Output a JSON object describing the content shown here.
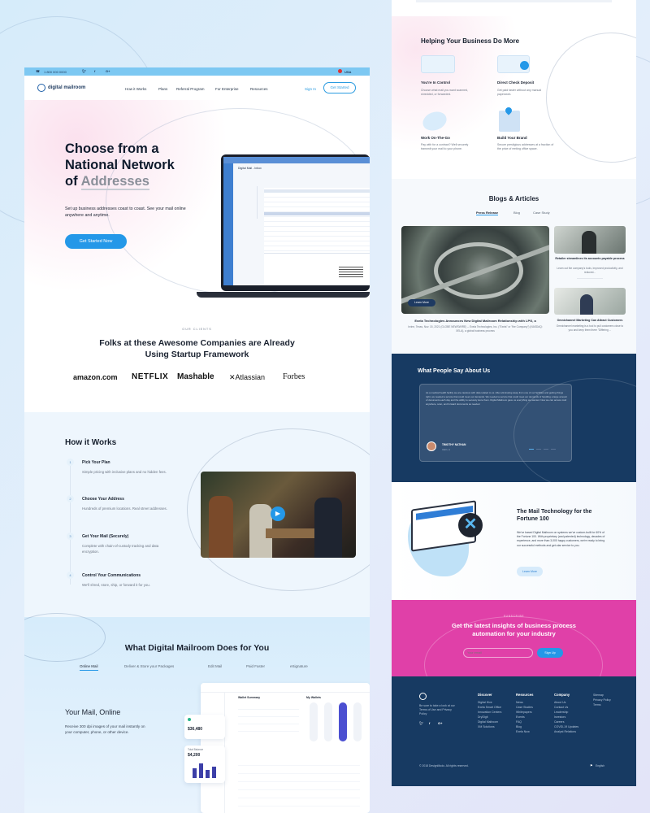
{
  "topbar": {
    "phone": "1 800 000 0000",
    "lang": "USA"
  },
  "nav": {
    "logo": "digital mailroom",
    "links": [
      "How it Works",
      "Plans",
      "Referral Program",
      "For Enterprise",
      "Resources"
    ],
    "signin": "Sign In",
    "cta": "Get Started"
  },
  "hero": {
    "title_line1": "Choose from a",
    "title_line2": "National Network",
    "title_of": "of",
    "title_highlight": "Addresses",
    "subtitle": "Set up business addresses coast to coast. See your mail online anywhere and anytime.",
    "cta": "Get Started Now",
    "mock_title": "Digital Mail - Inbox"
  },
  "clients": {
    "eyebrow": "OUR CLIENTS",
    "title": "Folks at these Awesome Companies are Already Using Startup Framework",
    "logos": [
      "amazon.com",
      "NETFLIX",
      "Mashable",
      "Atlassian",
      "Forbes"
    ]
  },
  "how": {
    "title": "How it Works",
    "steps": [
      {
        "num": "1",
        "title": "Pick Your Plan",
        "desc": "Simple pricing with inclusive plans and no hidden fees."
      },
      {
        "num": "2",
        "title": "Choose Your Address",
        "desc": "Hundreds of premium locations. Real street addresses."
      },
      {
        "num": "3",
        "title": "Get Your Mail (Securely)",
        "desc": "Complete with chain-of-custody tracking and data encryption."
      },
      {
        "num": "4",
        "title": "Control Your Communications",
        "desc": "We'll shred, store, ship, or forward it for you."
      }
    ]
  },
  "does": {
    "title": "What Digital Mailroom Does for You",
    "tabs": [
      "Online Mail",
      "Deliver & Store your Packages",
      "Edit Mail",
      "Paid Faster",
      "eSignature"
    ],
    "feature_title": "Your Mail, Online",
    "feature_desc": "Receive 300 dpi images of your mail instantly on your computer, phone, or other device.",
    "dash_wallet": "Wallet Summary",
    "dash_mywallets": "My Wallets",
    "balance1": "$36,480",
    "balance_label": "Total Balance",
    "balance2": "$4,200"
  },
  "helping": {
    "title": "Helping Your Business Do More",
    "items": [
      {
        "title": "You're In Control",
        "desc": "Choose what mail you want scanned, shredded, or forwarded."
      },
      {
        "title": "Direct Check Deposit",
        "desc": "Get paid faster without any manual paperwork."
      },
      {
        "title": "Work On-The-Go",
        "desc": "Pay with for a contract? Well securely transmit your mail to your phone."
      },
      {
        "title": "Build Your Brand",
        "desc": "Secure prestigious addresses at a fraction of the price of renting office space."
      }
    ]
  },
  "blogs": {
    "title": "Blogs & Articles",
    "tabs": [
      "Press Release",
      "Blog",
      "Case Study"
    ],
    "main_caption": "Exela Technologies Announces New Digital Mailroom Relationship with LPG, a",
    "main_desc": "Irvine, Texas, Nov. 15, 2021 (GLOBE NEWSWIRE) -- Exela Technologies, Inc. (\"Exela\" or \"the Company\") (NASDAQ: XELA), a global business process",
    "learn": "Learn More",
    "side1_title": "Retailer streamlines its accounts payable process",
    "side1_desc": "Learn out the company's tools, improved productivity, and reduced...",
    "side2_title": "Omnichannel Marketing Can Attract Customers",
    "side2_desc": "Omnichannel marketing is a tool to pull customers close to you and keep them there \"Differing ..."
  },
  "testimonials": {
    "title": "What People Say About Us",
    "quote": "As a medical health facility we are cautious with data related to us. After eliminating away from one of our facilities and getting things right, we needed a service that could meet our demands. We needed a service that could meet our demands of handling a large amount of documents each day and the ability to securely store them. Digital Mailroom gave us everything we wanted. Now we can access mail anywhere, scan, and forward documents as needed.",
    "name": "TIMOTHY NATHAN",
    "role": "CEO, A"
  },
  "fortune": {
    "title": "The Mail Technology for the Fortune 100",
    "desc": "We've based Digital Mailroom on systems we've custom-built for 60% of the Fortune 100. With proprietary (and patented) technology, decades of experience, and more than 3,000 happy customers, we're ready to bring our successful methods and get-star service to you.",
    "cta": "Learn More"
  },
  "subscribe": {
    "eyebrow": "SUBSCRIBE",
    "title": "Get the latest insights of business process automation for your industry",
    "placeholder": "Your email",
    "cta": "Sign Up"
  },
  "footer": {
    "about": "Be sure to take a look at our Terms of Use and Privacy Policy",
    "cols": [
      {
        "h": "Discover",
        "items": [
          "Digital Hive",
          "Exela Smart Office",
          "Innovation Centers",
          "DryDigit",
          "Digital Mailroom",
          "XM Solutions"
        ]
      },
      {
        "h": "Resources",
        "items": [
          "News",
          "Case Studies",
          "Whitepapers",
          "Events",
          "FAQ",
          "Blog",
          "Exela Now"
        ]
      },
      {
        "h": "Company",
        "items": [
          "About Us",
          "Contact Us",
          "Leadership",
          "Investors",
          "Careers",
          "COVID-19 Updates",
          "Analyst Relations"
        ]
      },
      {
        "h": "",
        "items": [
          "Sitemap",
          "Privacy Policy",
          "Terms"
        ]
      }
    ],
    "copyright": "© 2018 DesignModo. All rights reserved.",
    "lang": "English"
  },
  "colors": {
    "accent": "#2498e8",
    "navy": "#173a62",
    "pink": "#e040a8"
  }
}
